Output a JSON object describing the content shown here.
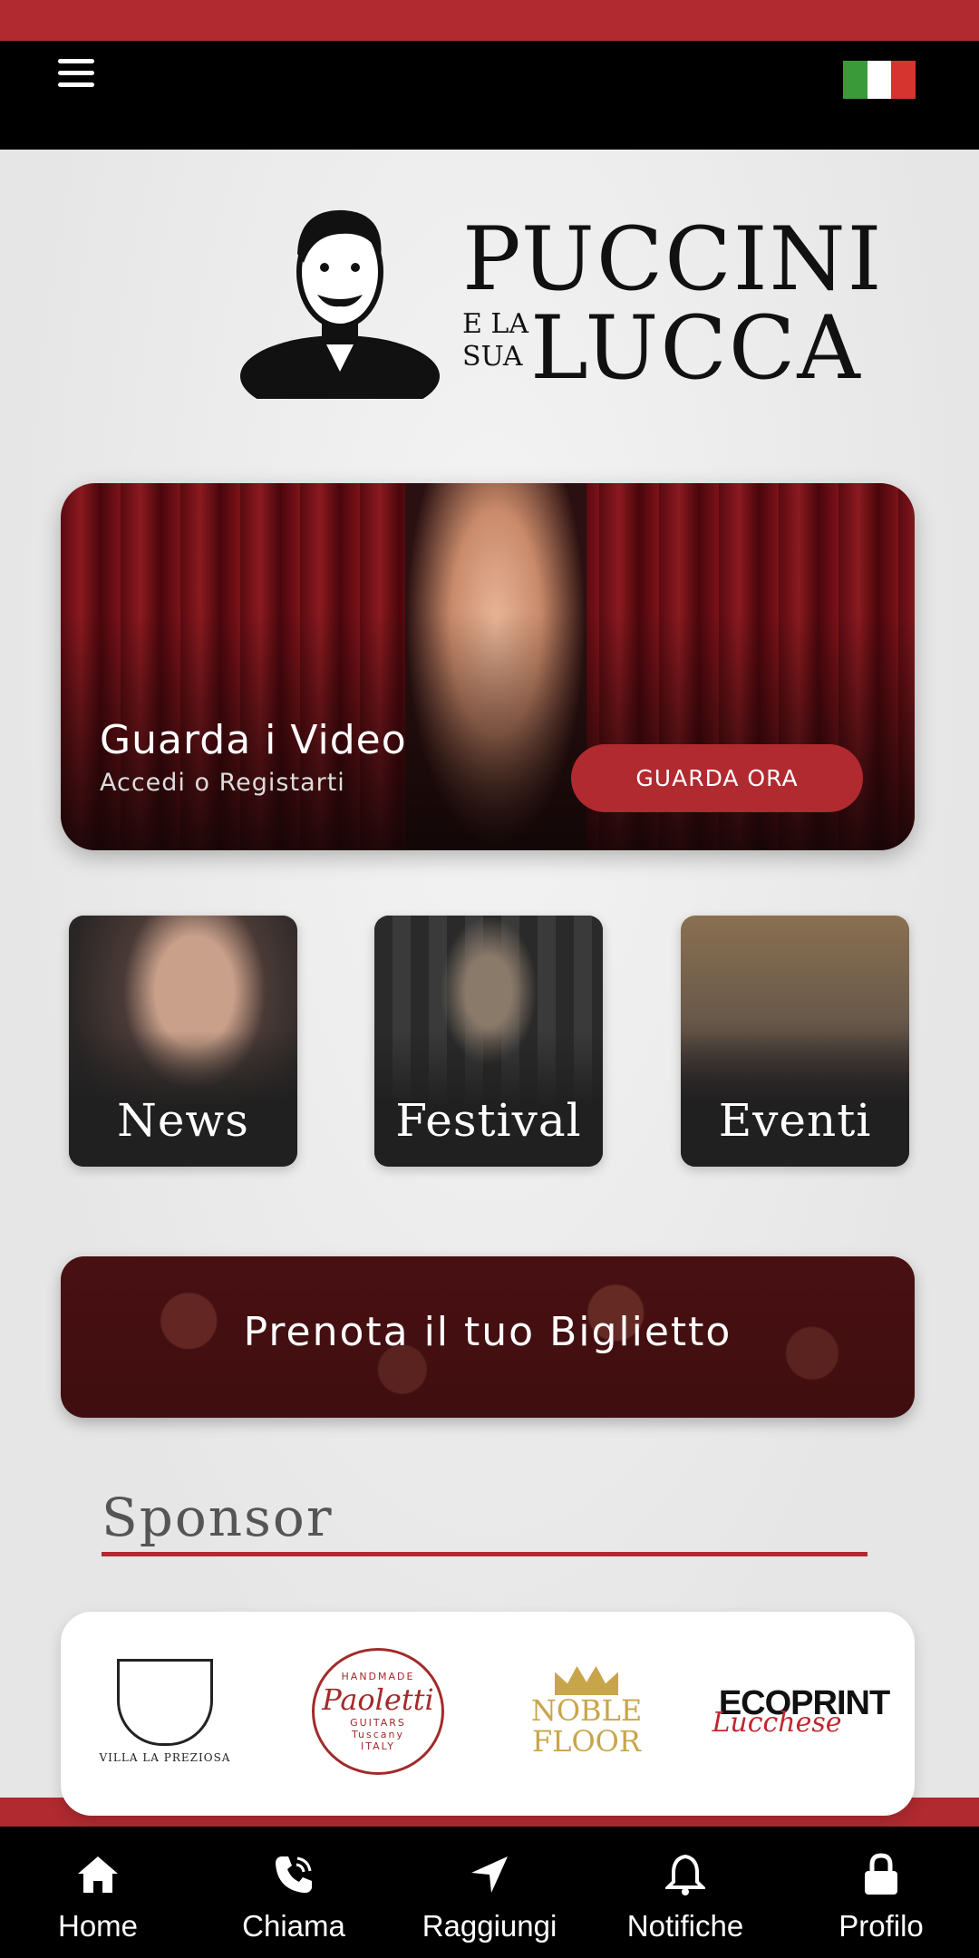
{
  "colors": {
    "accent": "#b02a30",
    "topbar": "#000000",
    "nav": "#000000"
  },
  "header": {
    "menu_icon": "hamburger-menu-icon",
    "language_flag": "italian-flag-icon"
  },
  "logo": {
    "line1": "PUCCINI",
    "small": [
      "E LA",
      "SUA"
    ],
    "line2": "LUCCA"
  },
  "hero": {
    "title": "Guarda i Video",
    "subtitle": "Accedi o Registarti",
    "button": "GUARDA ORA"
  },
  "tiles": [
    {
      "label": "News"
    },
    {
      "label": "Festival"
    },
    {
      "label": "Eventi"
    }
  ],
  "ticket": {
    "label": "Prenota il tuo Biglietto"
  },
  "sponsor": {
    "title": "Sponsor",
    "logos": {
      "villa": "VILLA LA PREZIOSA",
      "paoletti_top": "HANDMADE",
      "paoletti": "Paoletti",
      "paoletti_bottom": "GUITARS",
      "paoletti_sub": "Tuscany",
      "paoletti_country": "ITALY",
      "noble": "NOBLE",
      "floor": "FLOOR",
      "eco": "ECOPRINT",
      "eco_sub": "Lucchese"
    }
  },
  "nav": [
    {
      "label": "Home",
      "icon": "home-icon"
    },
    {
      "label": "Chiama",
      "icon": "phone-icon"
    },
    {
      "label": "Raggiungi",
      "icon": "navigation-arrow-icon"
    },
    {
      "label": "Notifiche",
      "icon": "bell-icon"
    },
    {
      "label": "Profilo",
      "icon": "lock-icon"
    }
  ]
}
